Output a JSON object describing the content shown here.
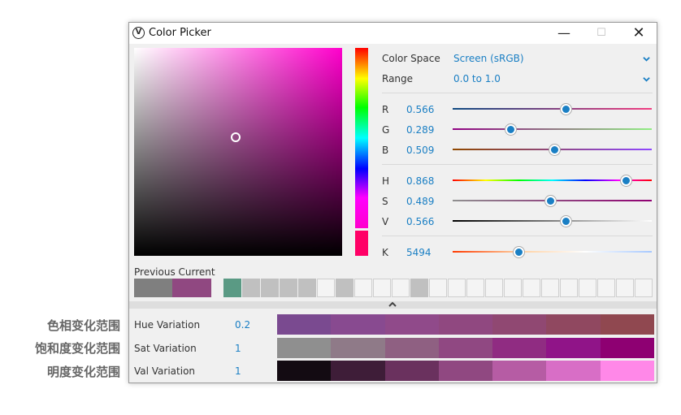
{
  "annotations": {
    "hue": "色相变化范围",
    "sat": "饱和度变化范围",
    "val": "明度变化范围"
  },
  "window": {
    "title": "Color Picker",
    "minimize": "—",
    "maximize": "☐",
    "close": "✕"
  },
  "properties": {
    "color_space_label": "Color Space",
    "color_space_value": "Screen (sRGB)",
    "range_label": "Range",
    "range_value": "0.0 to 1.0"
  },
  "channels": [
    {
      "label": "R",
      "value": "0.566",
      "fraction": 0.566,
      "gradient": [
        "#0f4a82",
        "#f23d82"
      ]
    },
    {
      "label": "G",
      "value": "0.289",
      "fraction": 0.289,
      "gradient": [
        "#900082",
        "#90ee82"
      ]
    },
    {
      "label": "B",
      "value": "0.509",
      "fraction": 0.509,
      "gradient": [
        "#904800",
        "#9048ff"
      ]
    },
    {
      "label": "H",
      "value": "0.868",
      "fraction": 0.868,
      "gradient": [
        "#ff0000",
        "#ffff00",
        "#00ff00",
        "#00ffff",
        "#0000ff",
        "#ff00ff",
        "#ff0000"
      ]
    },
    {
      "label": "S",
      "value": "0.489",
      "fraction": 0.489,
      "gradient": [
        "#909090",
        "#900072"
      ]
    },
    {
      "label": "V",
      "value": "0.566",
      "fraction": 0.566,
      "gradient": [
        "#000000",
        "#ffffff"
      ]
    },
    {
      "label": "K",
      "value": "5494",
      "fraction": 0.33,
      "gradient": [
        "#ff3a00",
        "#ffcf9f",
        "#ffffff",
        "#a6c8ff"
      ]
    }
  ],
  "swatches": {
    "label": "Previous Current",
    "previous": "#7f7f7f",
    "current": "#904881"
  },
  "palette": [
    "teal",
    "filled",
    "filled",
    "filled",
    "filled",
    "empty",
    "filled",
    "empty",
    "empty",
    "empty",
    "filled",
    "empty",
    "empty",
    "empty",
    "empty",
    "empty",
    "empty",
    "empty",
    "empty",
    "empty",
    "empty",
    "empty",
    "empty"
  ],
  "variations": [
    {
      "label": "Hue Variation",
      "value": "0.2",
      "colors": [
        "#7a4a90",
        "#884a90",
        "#904a8a",
        "#904880",
        "#904872",
        "#904860",
        "#904850"
      ]
    },
    {
      "label": "Sat Variation",
      "value": "1",
      "colors": [
        "#8f8f8f",
        "#8f7a88",
        "#8f6082",
        "#904882",
        "#902c82",
        "#901488",
        "#8e0072"
      ]
    },
    {
      "label": "Val Variation",
      "value": "1",
      "colors": [
        "#130b12",
        "#3e1d38",
        "#6a315e",
        "#904881",
        "#b65ca4",
        "#d86ec6",
        "#ff88e8"
      ]
    }
  ]
}
